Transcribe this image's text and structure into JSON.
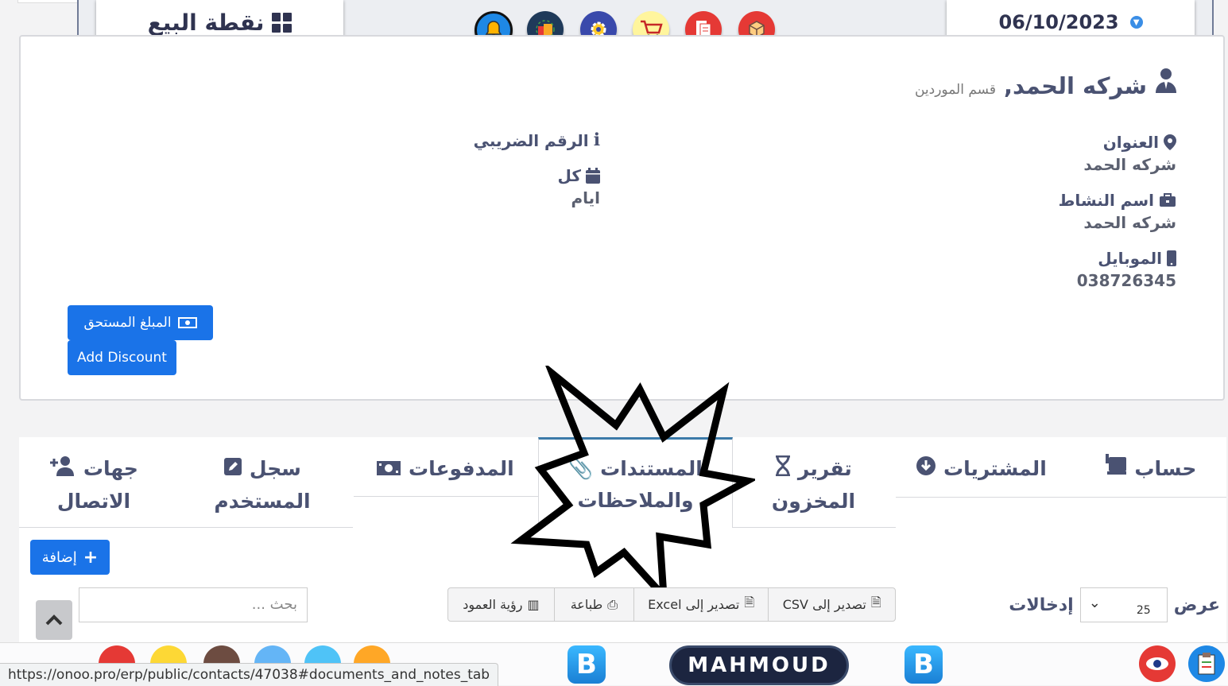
{
  "header": {
    "pos_label": "نقطة البيع",
    "date": "06/10/2023"
  },
  "contact": {
    "name": "شركه الحمد,",
    "section": "قسم الموردين",
    "address_label": "العنوان",
    "address_value": "شركه الحمد",
    "business_label": "اسم النشاط",
    "business_value": "شركه الحمد",
    "mobile_label": "الموبايل",
    "mobile_value": "038726345",
    "tax_label": "الرقم الضريبي",
    "pay_term_label": "كل",
    "pay_term_value": "ايام",
    "due_button": "المبلغ المستحق",
    "discount_button": "Add Discount"
  },
  "tabs": {
    "account": "حساب",
    "purchases": "المشتريات",
    "stock_line1": "تقرير",
    "stock_line2": "المخزون",
    "docs_line1": "المستندات",
    "docs_line2": "والملاحظات",
    "payments": "المدفوعات",
    "log_line1": "سجل",
    "log_line2": "المستخدم",
    "contacts_line1": "جهات",
    "contacts_line2": "الاتصال"
  },
  "table": {
    "add_button": "إضافة",
    "show_label": "عرض",
    "entries_value": "25",
    "entries_label": "إدخالات",
    "export_csv": "تصدير إلى CSV",
    "export_excel": "تصدير إلى Excel",
    "print": "طباعة",
    "column_visibility": "رؤية العمود",
    "search_placeholder": "بحث ..."
  },
  "bottombar": {
    "user_badge": "MAHMOUD",
    "status_url": "https://onoo.pro/erp/public/contacts/47038#documents_and_notes_tab",
    "b_letter": "B"
  },
  "colors": {
    "accent_blue": "#1a73e8",
    "heading": "#4a5272",
    "active_tab_border": "#3c7aa8"
  }
}
